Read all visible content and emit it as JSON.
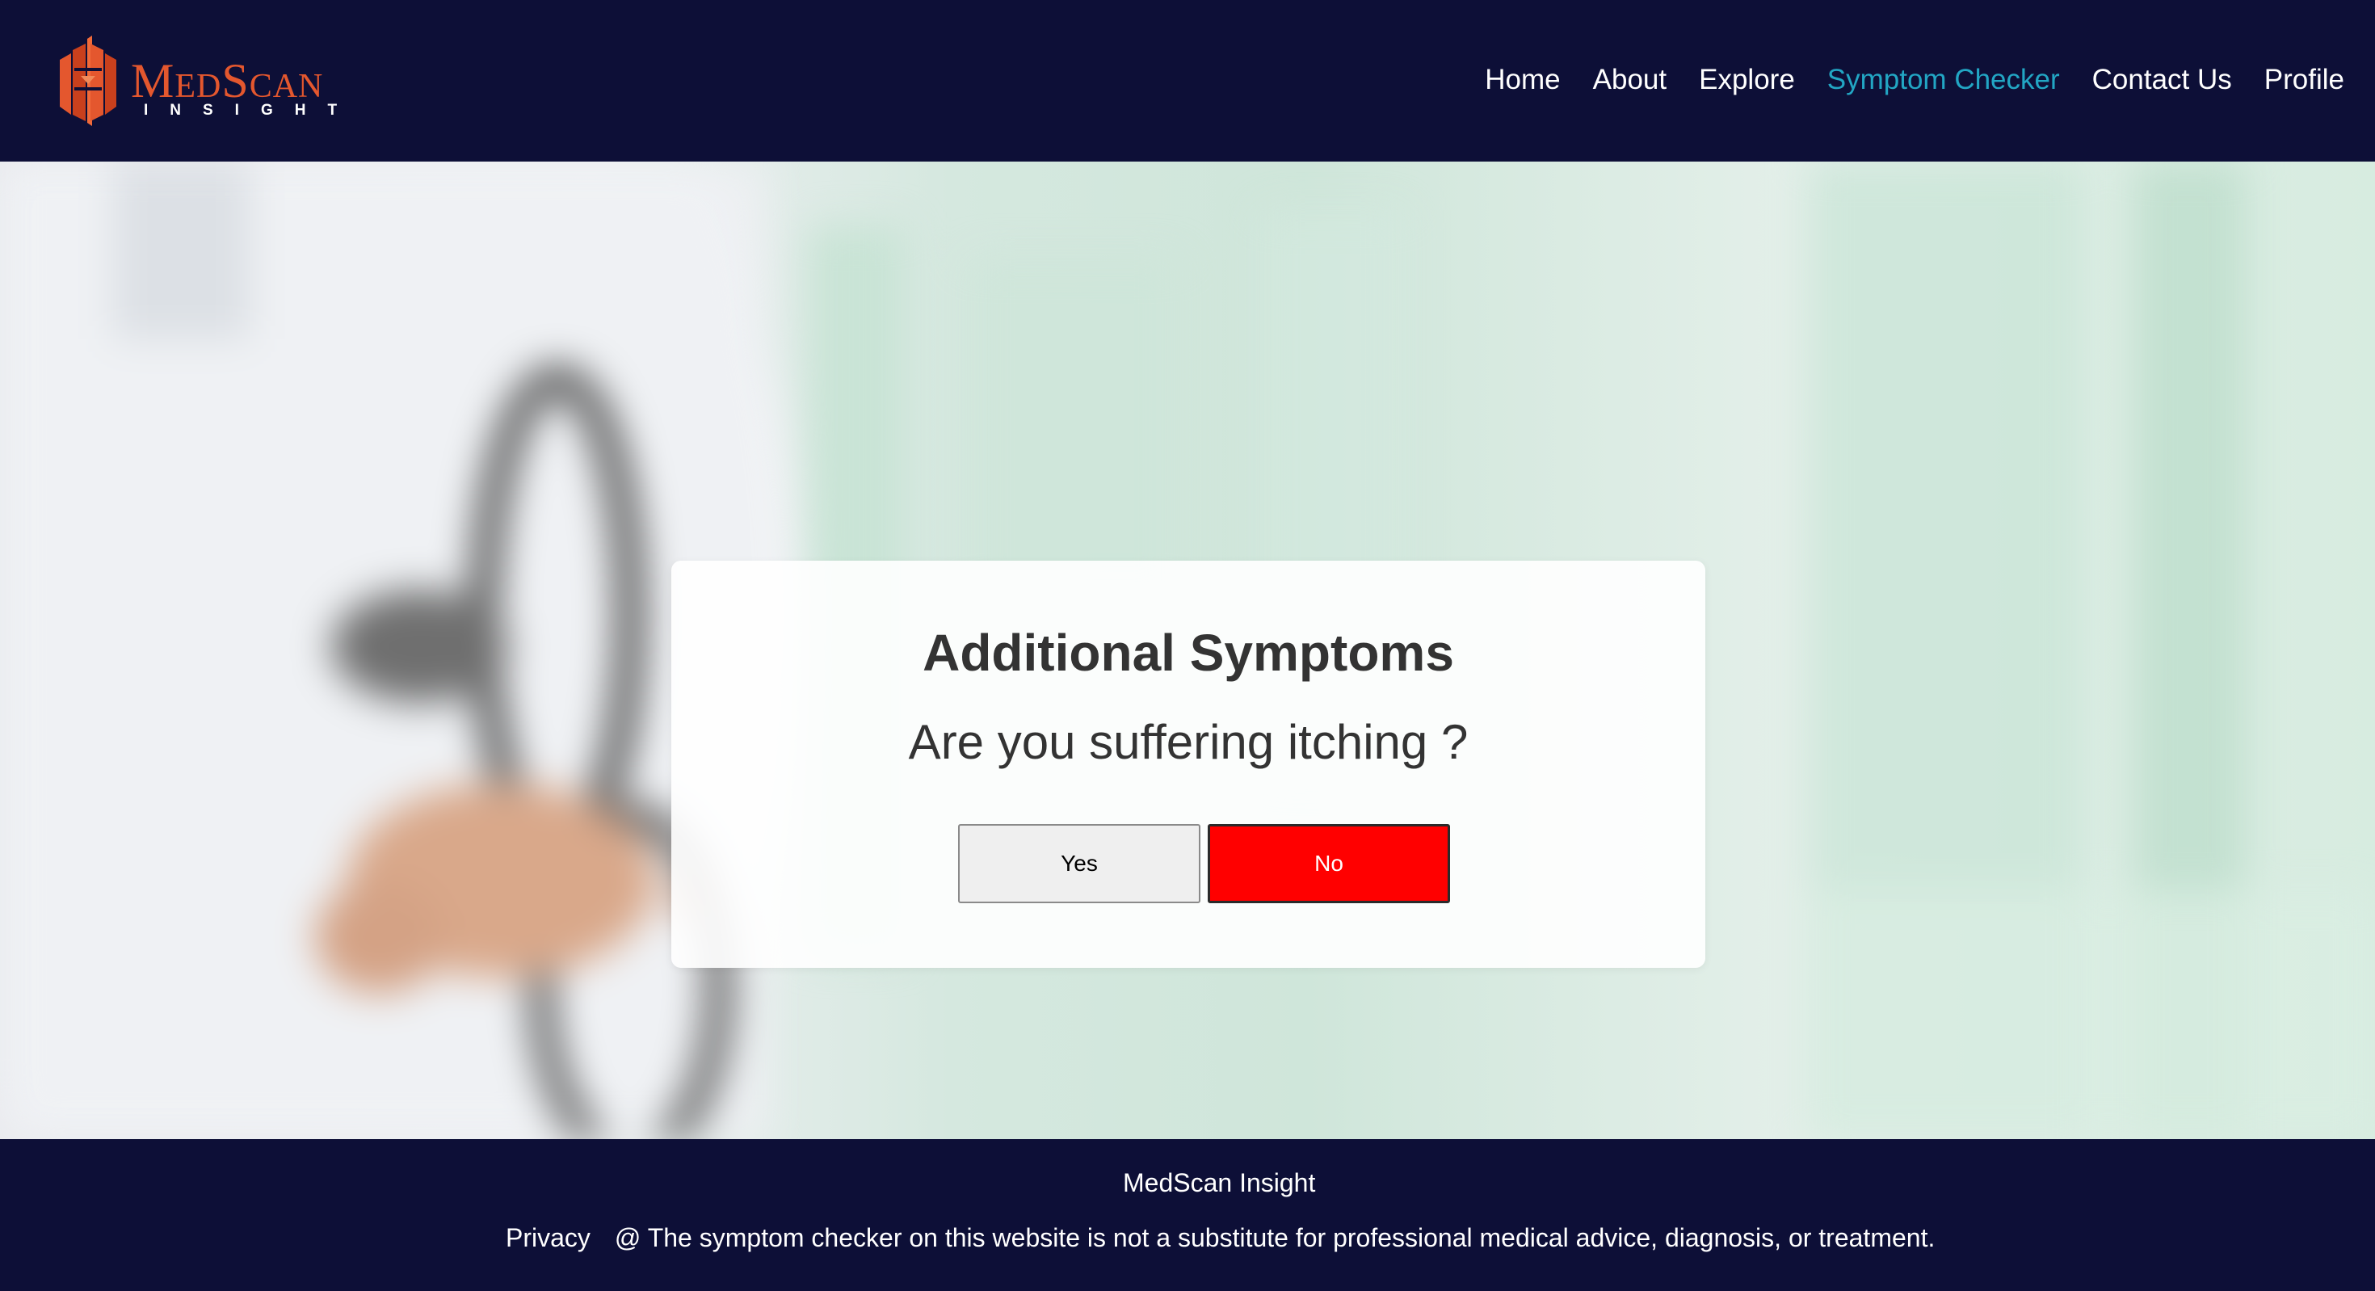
{
  "header": {
    "logo": {
      "title": "MedScan",
      "subtitle": "INSIGHT",
      "mark_color": "#e4572e"
    },
    "nav": [
      {
        "label": "Home",
        "active": false
      },
      {
        "label": "About",
        "active": false
      },
      {
        "label": "Explore",
        "active": false
      },
      {
        "label": "Symptom Checker",
        "active": true
      },
      {
        "label": "Contact Us",
        "active": false
      },
      {
        "label": "Profile",
        "active": false
      }
    ],
    "bg_color": "#0d0f37",
    "active_color": "#22a6c4"
  },
  "card": {
    "title": "Additional Symptoms",
    "question": "Are you suffering itching ?",
    "yes_label": "Yes",
    "no_label": "No",
    "no_color": "#ff0000"
  },
  "footer": {
    "brand": "MedScan Insight",
    "privacy_label": "Privacy",
    "disclaimer": "@ The symptom checker on this website is not a substitute for professional medical advice, diagnosis, or treatment."
  }
}
